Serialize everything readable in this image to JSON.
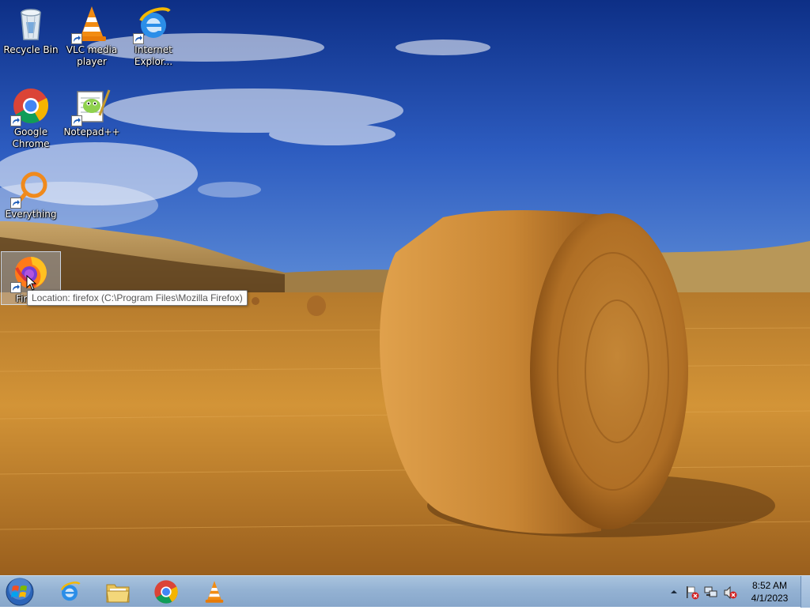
{
  "desktop": {
    "icons": [
      {
        "label": "Recycle Bin",
        "icon": "recycle-bin-icon"
      },
      {
        "label": "VLC media player",
        "icon": "vlc-icon"
      },
      {
        "label": "Internet Explor...",
        "icon": "internet-explorer-icon"
      },
      {
        "label": "Google Chrome",
        "icon": "chrome-icon"
      },
      {
        "label": "Notepad++",
        "icon": "notepadpp-icon"
      },
      {
        "label": "Everything",
        "icon": "everything-icon"
      },
      {
        "label": "Fir",
        "icon": "firefox-icon"
      }
    ],
    "tooltip": "Location: firefox (C:\\Program Files\\Mozilla Firefox)"
  },
  "taskbar": {
    "start_icon": "windows-start-icon",
    "pinned": [
      {
        "name": "Internet Explorer",
        "icon": "internet-explorer-icon"
      },
      {
        "name": "Windows Explorer",
        "icon": "folder-icon"
      },
      {
        "name": "Google Chrome",
        "icon": "chrome-icon"
      },
      {
        "name": "VLC media player",
        "icon": "vlc-icon"
      }
    ],
    "tray": {
      "icons": [
        "show-hidden-icons-arrow",
        "action-center-flag-icon",
        "network-icon",
        "volume-muted-icon"
      ],
      "time": "8:52 AM",
      "date": "4/1/2023"
    }
  },
  "colors": {
    "sky": "#1f48a8",
    "field": "#c98a2e",
    "taskbar": "#94b2d3"
  }
}
